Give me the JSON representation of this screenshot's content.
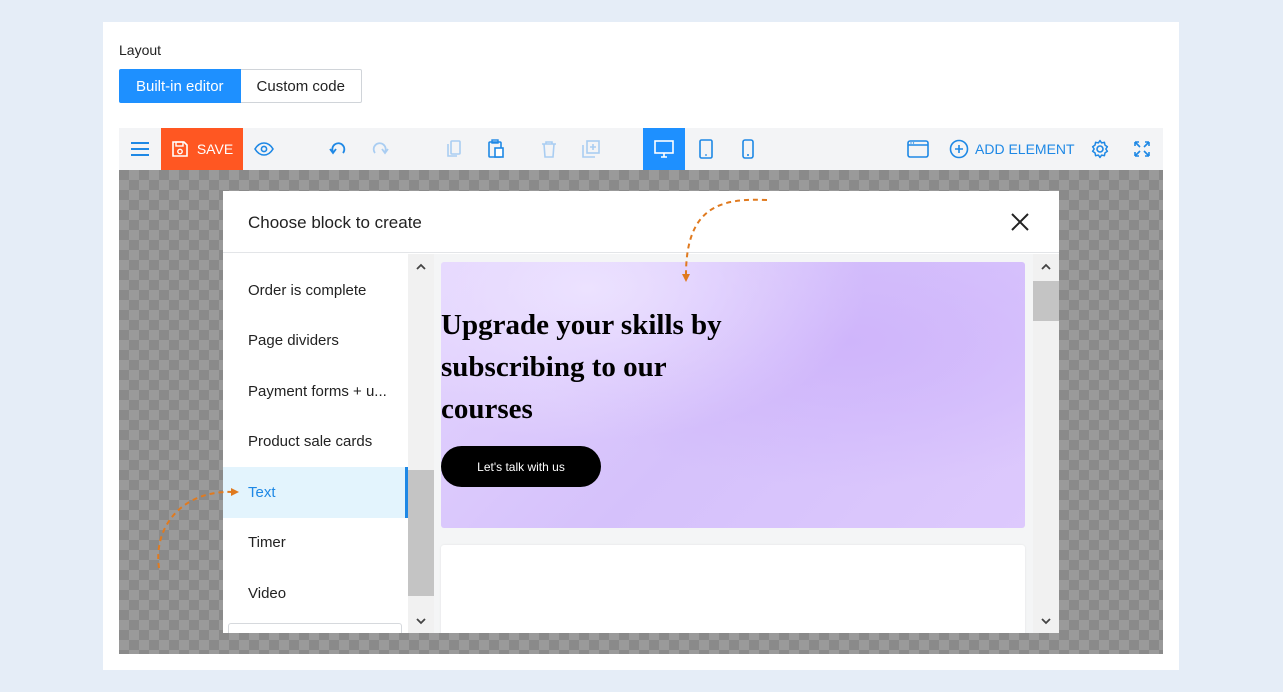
{
  "layout": {
    "label": "Layout",
    "tabs": [
      {
        "label": "Built-in editor",
        "active": true
      },
      {
        "label": "Custom code",
        "active": false
      }
    ]
  },
  "toolbar": {
    "save_label": "SAVE",
    "add_element_label": "ADD ELEMENT",
    "accent_color": "#1e90ff",
    "save_color": "#ff5722",
    "icons": [
      "menu-icon",
      "save-icon",
      "eye-icon",
      "undo-icon",
      "redo-icon",
      "copy-icon",
      "paste-icon",
      "delete-icon",
      "duplicate-icon",
      "desktop-icon",
      "tablet-icon",
      "mobile-icon",
      "browser-window-icon",
      "add-circle-icon",
      "gear-icon",
      "fullscreen-icon"
    ],
    "active_device": "desktop"
  },
  "modal": {
    "title": "Choose block to create",
    "categories": [
      {
        "label": "Order is complete"
      },
      {
        "label": "Page dividers"
      },
      {
        "label": "Payment forms + u..."
      },
      {
        "label": "Product sale cards"
      },
      {
        "label": "Text",
        "active": true
      },
      {
        "label": "Timer"
      },
      {
        "label": "Video"
      }
    ],
    "preview": {
      "heading": "Upgrade your skills by subscribing to our courses",
      "button_label": "Let's talk with us"
    }
  }
}
